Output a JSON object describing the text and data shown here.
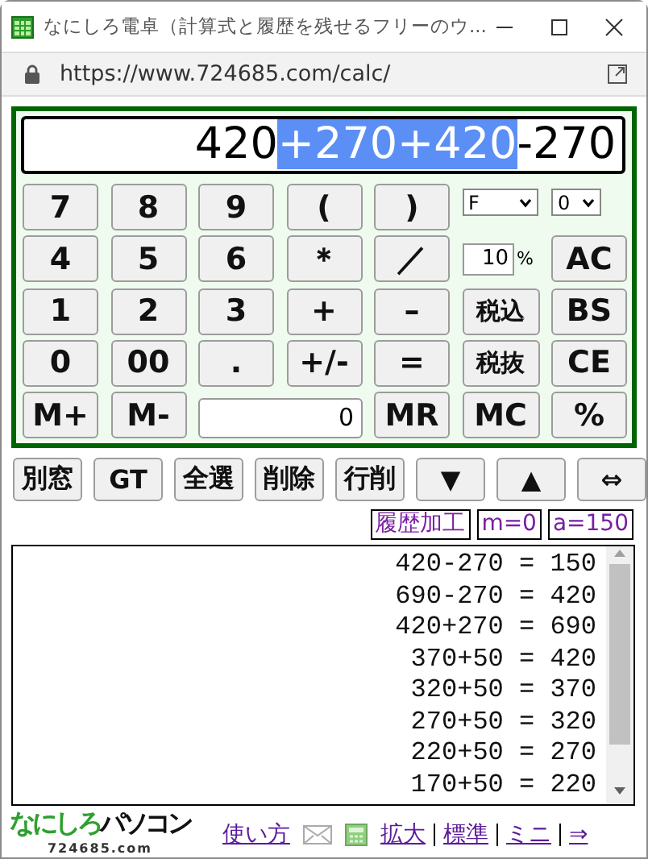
{
  "window": {
    "title": "なにしろ電卓（計算式と履歴を残せるフリーのウ..."
  },
  "address_bar": {
    "url": "https://www.724685.com/calc/"
  },
  "display": {
    "segments": [
      {
        "text": "420",
        "selected": false
      },
      {
        "text": "+270+420",
        "selected": true
      },
      {
        "text": "-270",
        "selected": false
      }
    ]
  },
  "keypad": {
    "rows": [
      [
        {
          "kind": "key",
          "label": "7"
        },
        {
          "kind": "key",
          "label": "8"
        },
        {
          "kind": "key",
          "label": "9"
        },
        {
          "kind": "key",
          "label": "("
        },
        {
          "kind": "key",
          "label": ")"
        },
        {
          "kind": "select",
          "value": "F"
        },
        {
          "kind": "select",
          "value": "0"
        }
      ],
      [
        {
          "kind": "key",
          "label": "4"
        },
        {
          "kind": "key",
          "label": "5"
        },
        {
          "kind": "key",
          "label": "6"
        },
        {
          "kind": "key",
          "label": "＊"
        },
        {
          "kind": "key",
          "label": "／"
        },
        {
          "kind": "rate",
          "value": "10",
          "unit": "%"
        },
        {
          "kind": "key",
          "label": "AC"
        }
      ],
      [
        {
          "kind": "key",
          "label": "1"
        },
        {
          "kind": "key",
          "label": "2"
        },
        {
          "kind": "key",
          "label": "3"
        },
        {
          "kind": "key",
          "label": "+"
        },
        {
          "kind": "key",
          "label": "–"
        },
        {
          "kind": "key",
          "label": "税込"
        },
        {
          "kind": "key",
          "label": "BS"
        }
      ],
      [
        {
          "kind": "key",
          "label": "0"
        },
        {
          "kind": "key",
          "label": "00"
        },
        {
          "kind": "key",
          "label": "."
        },
        {
          "kind": "key",
          "label": "+/-"
        },
        {
          "kind": "key",
          "label": "="
        },
        {
          "kind": "key",
          "label": "税抜"
        },
        {
          "kind": "key",
          "label": "CE"
        }
      ]
    ],
    "memory_row": {
      "left_keys": [
        "M+",
        "M-"
      ],
      "memory_value": "0",
      "right_keys": [
        "MR",
        "MC",
        "%"
      ]
    }
  },
  "toolbar": [
    "別窓",
    "GT",
    "全選",
    "削除",
    "行削",
    "▼",
    "▲",
    "⇔"
  ],
  "indicators": [
    "履歴加工",
    "m=0",
    "a=150"
  ],
  "history": [
    "420-270 = 150",
    "690-270 = 420",
    "420+270 = 690",
    "370+50 = 420",
    "320+50 = 370",
    "270+50 = 320",
    "220+50 = 270",
    "170+50 = 220"
  ],
  "footer": {
    "logo": "なにしろパソコン",
    "logo_domain": "724685.com",
    "items": [
      {
        "kind": "link",
        "label": "使い方"
      },
      {
        "kind": "mail"
      },
      {
        "kind": "calculator"
      },
      {
        "kind": "link",
        "label": "拡大"
      },
      {
        "kind": "divider"
      },
      {
        "kind": "link",
        "label": "標準"
      },
      {
        "kind": "divider"
      },
      {
        "kind": "link",
        "label": "ミニ"
      },
      {
        "kind": "divider"
      },
      {
        "kind": "link",
        "label": "⇒"
      }
    ]
  }
}
